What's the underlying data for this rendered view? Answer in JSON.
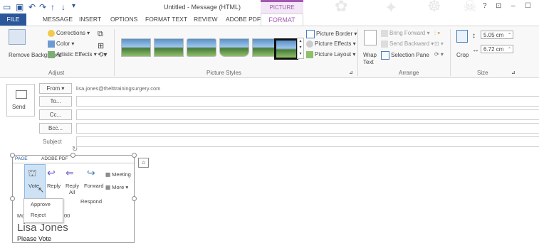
{
  "window": {
    "title": "Untitled - Message (HTML)",
    "context_tab_group": "PICTURE TOOLS",
    "controls": [
      "?",
      "restore",
      "minimize",
      "maximize"
    ]
  },
  "qat": {
    "icons": [
      "mail-icon",
      "save-icon",
      "undo-icon",
      "redo-icon",
      "up-icon",
      "down-icon",
      "customize-icon"
    ]
  },
  "tabs": {
    "file": "FILE",
    "message": "MESSAGE",
    "insert": "INSERT",
    "options": "OPTIONS",
    "format_text": "FORMAT TEXT",
    "review": "REVIEW",
    "adobe_pdf": "ADOBE PDF",
    "format": "FORMAT"
  },
  "ribbon": {
    "adjust": {
      "remove_background": "Remove Background",
      "corrections": "Corrections",
      "color": "Color",
      "artistic_effects": "Artistic Effects",
      "label": "Adjust"
    },
    "picture_styles": {
      "label": "Picture Styles",
      "border": "Picture Border",
      "effects": "Picture Effects",
      "layout": "Picture Layout"
    },
    "arrange": {
      "label": "Arrange",
      "wrap_text_1": "Wrap",
      "wrap_text_2": "Text",
      "bring_forward": "Bring Forward",
      "send_backward": "Send Backward",
      "selection_pane": "Selection Pane"
    },
    "size": {
      "label": "Size",
      "crop": "Crop",
      "height": "5.05 cm",
      "width": "6.72 cm"
    }
  },
  "mail": {
    "send": "Send",
    "from_label": "From",
    "from_value": "lisa.jones@thelttrainingsurgery.com",
    "to": "To...",
    "cc": "Cc...",
    "bcc": "Bcc...",
    "subject": "Subject"
  },
  "embedded": {
    "tab_page": "PAGE",
    "tab_adobe": "ADOBE PDF",
    "vote": "Vote",
    "reply": "Reply",
    "reply_all_1": "Reply",
    "reply_all_2": "All",
    "forward": "Forward",
    "meeting": "Meeting",
    "more": "More",
    "respond": "Respond",
    "approve": "Approve",
    "reject": "Reject",
    "mo_text": "Mo",
    "time_frag": "00",
    "name": "Lisa Jones",
    "please_vote": "Please Vote"
  },
  "colors": {
    "file_tab": "#2b579a",
    "picture_tools": "#a05ab0"
  }
}
